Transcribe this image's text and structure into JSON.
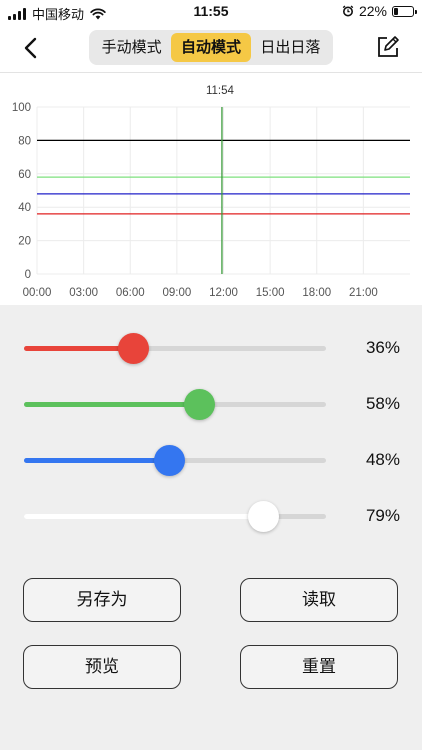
{
  "status_bar": {
    "carrier": "中国移动",
    "time": "11:55",
    "battery": "22%",
    "battery_level": 0.22
  },
  "header": {
    "tabs": [
      {
        "label": "手动模式",
        "active": false
      },
      {
        "label": "自动模式",
        "active": true
      },
      {
        "label": "日出日落",
        "active": false
      }
    ]
  },
  "chart_data": {
    "type": "line",
    "title": "",
    "xlabel": "",
    "ylabel": "",
    "ylim": [
      0,
      100
    ],
    "xlim": [
      "00:00",
      "24:00"
    ],
    "y_ticks": [
      "0",
      "20",
      "40",
      "60",
      "80",
      "100"
    ],
    "x_ticks": [
      "00:00",
      "03:00",
      "06:00",
      "09:00",
      "12:00",
      "15:00",
      "18:00",
      "21:00"
    ],
    "grid": true,
    "current_time_marker": {
      "label": "11:54",
      "x": "11:54",
      "color": "#3a9a3a"
    },
    "series": [
      {
        "color": "#000000",
        "values": [
          80,
          80
        ]
      },
      {
        "color": "#7ee07e",
        "values": [
          58,
          58
        ]
      },
      {
        "color": "#2020c8",
        "values": [
          48,
          48
        ]
      },
      {
        "color": "#e02020",
        "values": [
          36,
          36
        ]
      }
    ]
  },
  "sliders": [
    {
      "label": "36%",
      "value": 0.36,
      "color": "#e8443a",
      "thumb_color": "#e8443a"
    },
    {
      "label": "58%",
      "value": 0.58,
      "color": "#5cc15c",
      "thumb_color": "#5cc15c"
    },
    {
      "label": "48%",
      "value": 0.48,
      "color": "#3476f0",
      "thumb_color": "#3476f0"
    },
    {
      "label": "79%",
      "value": 0.79,
      "color": "#ffffff",
      "thumb_color": "#ffffff"
    }
  ],
  "buttons": {
    "save_as": "另存为",
    "read": "读取",
    "preview": "预览",
    "reset": "重置"
  }
}
